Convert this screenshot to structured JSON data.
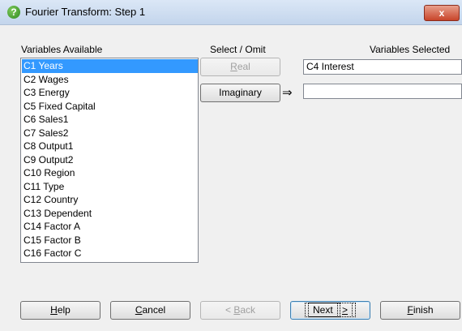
{
  "window": {
    "title": "Fourier Transform: Step 1",
    "close_glyph": "x"
  },
  "labels": {
    "variables_available": "Variables Available",
    "select_omit": "Select / Omit",
    "variables_selected": "Variables Selected"
  },
  "variables_available": {
    "selected_index": 0,
    "items": [
      "C1 Years",
      "C2 Wages",
      "C3 Energy",
      "C5 Fixed Capital",
      "C6 Sales1",
      "C7 Sales2",
      "C8 Output1",
      "C9 Output2",
      "C10 Region",
      "C11 Type",
      "C12 Country",
      "C13 Dependent",
      "C14 Factor A",
      "C15 Factor B",
      "C16 Factor C"
    ]
  },
  "buttons": {
    "real": {
      "pre": "",
      "accel": "R",
      "post": "eal"
    },
    "imaginary": "Imaginary",
    "help": {
      "pre": "",
      "accel": "H",
      "post": "elp"
    },
    "cancel": {
      "pre": "",
      "accel": "C",
      "post": "ancel"
    },
    "back": {
      "pre": "< ",
      "accel": "B",
      "post": "ack"
    },
    "next": {
      "pre": "Next ",
      "accel": ">",
      "post": ""
    },
    "finish": {
      "pre": "",
      "accel": "F",
      "post": "inish"
    }
  },
  "fields": {
    "real_selected": "C4 Interest",
    "imaginary_selected": ""
  },
  "arrow_glyph": "⇒"
}
